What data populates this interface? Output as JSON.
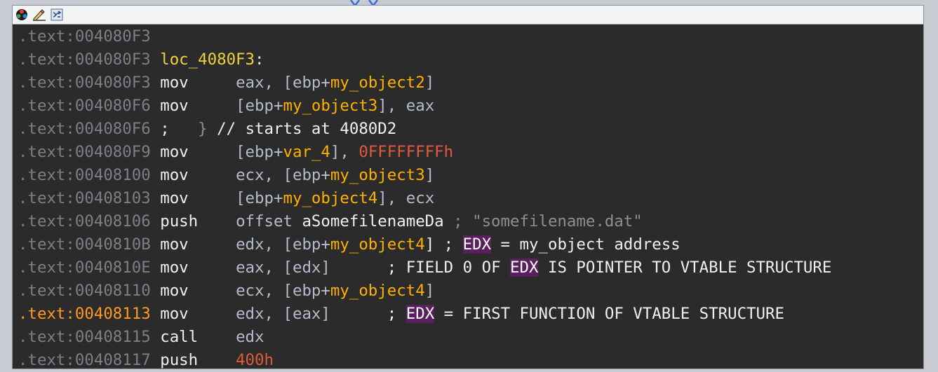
{
  "toolbar": {
    "icons": [
      "graph-view-icon",
      "edit-icon",
      "sync-icon"
    ]
  },
  "colors": {
    "address": "#7b7f86",
    "current_address": "#ff9a1f",
    "variable": "#ffb000",
    "number": "#e05a3c",
    "label": "#f0d23c",
    "highlight": "#5a1f5e"
  },
  "lines": [
    {
      "addr": ".text:004080F3"
    },
    {
      "addr": ".text:004080F3",
      "label": "loc_4080F3",
      "colon": ":"
    },
    {
      "addr": ".text:004080F3",
      "mnem": "mov",
      "a1": "eax, [ebp+",
      "v1": "my_object2",
      "a2": "]"
    },
    {
      "addr": ".text:004080F6",
      "mnem": "mov",
      "a1": "[ebp+",
      "v1": "my_object3",
      "a2": "], eax"
    },
    {
      "addr": ".text:004080F6",
      "semi": ";",
      "brace": "}",
      "comment": "// starts at 4080D2"
    },
    {
      "addr": ".text:004080F9",
      "mnem": "mov",
      "a1": "[ebp+",
      "v1": "var_4",
      "a2": "], ",
      "num": "0FFFFFFFFh"
    },
    {
      "addr": ".text:00408100",
      "mnem": "mov",
      "a1": "ecx, [ebp+",
      "v1": "my_object3",
      "a2": "]"
    },
    {
      "addr": ".text:00408103",
      "mnem": "mov",
      "a1": "[ebp+",
      "v1": "my_object4",
      "a2": "], ecx"
    },
    {
      "addr": ".text:00408106",
      "mnem": "push",
      "a1": "offset ",
      "sym": "aSomefilenameDa",
      "cmt": "; \"somefilename.dat\""
    },
    {
      "addr": ".text:0040810B",
      "mnem": "mov",
      "a1": "edx, [ebp+",
      "v1": "my_object4",
      "a2": "] ; ",
      "hl": "EDX",
      "rest": " = my_object address"
    },
    {
      "addr": ".text:0040810E",
      "mnem": "mov",
      "a1": "eax, [edx]",
      "semi": ";",
      "pre": " FIELD 0 OF ",
      "hl": "EDX",
      "rest": " IS POINTER TO VTABLE STRUCTURE"
    },
    {
      "addr": ".text:00408110",
      "mnem": "mov",
      "a1": "ecx, [ebp+",
      "v1": "my_object4",
      "a2": "]"
    },
    {
      "addr": ".text:00408113",
      "mnem": "mov",
      "a1": "edx, [eax]",
      "semi": ";",
      "hl": "EDX",
      "rest": " = FIRST FUNCTION OF VTABLE STRUCTURE"
    },
    {
      "addr": ".text:00408115",
      "mnem": "call",
      "a1": "edx"
    },
    {
      "addr": ".text:00408117",
      "mnem": "push",
      "num": "400h"
    }
  ]
}
